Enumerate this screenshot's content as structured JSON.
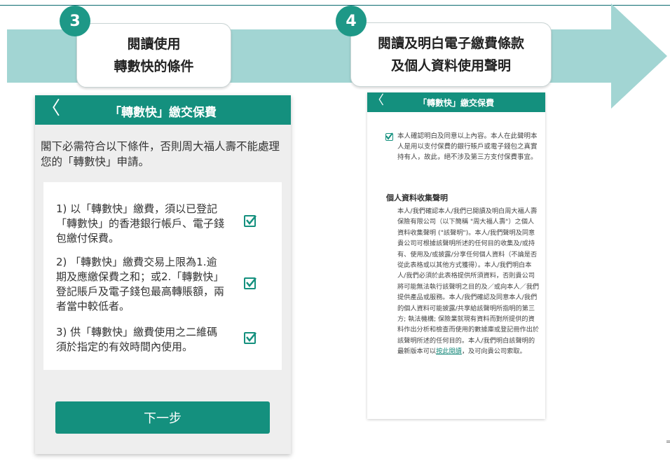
{
  "colors": {
    "teal": "#14907e",
    "arrow": "#a2d5d3",
    "step": "#1e9887"
  },
  "steps": [
    {
      "number": "3",
      "line1": "閱讀使用",
      "line2": "轉數快的條件"
    },
    {
      "number": "4",
      "line1": "閱讀及明白電子繳費條款",
      "line2": "及個人資料使用聲明"
    }
  ],
  "phone1": {
    "title": "「轉數快」繳交保費",
    "back_icon": "chevron-left-icon",
    "intro": "閣下必需符合以下條件，否則周大福人壽不能處理您的「轉數快」申請。",
    "conditions": [
      "1) 以「轉數快」繳費，須以已登記「轉數快」的香港銀行帳戶、電子錢包繳付保費。",
      "2) 「轉數快」繳費交易上限為1.逾期及應繳保費之和；或2.「轉數快」登記賬戶及電子錢包最高轉賬額，兩者當中較低者。",
      "3) 供「轉數快」繳費使用之二維碼須於指定的有效時間內使用。"
    ],
    "next_label": "下一步"
  },
  "phone2": {
    "title": "「轉數快」繳交保費",
    "back_icon": "chevron-left-icon",
    "confirm_text": "本人確認明白及同意以上內容。本人在此聲明本人是用以支付保費的銀行賬戶或電子錢包之真實持有人，故此，絕不涉及第三方支付保費事宜。",
    "section_title": "個人資料收集聲明",
    "body_text": "本人/我們確認本人/我們已閱讀及明白周大福人壽保險有限公司（以下簡稱 \"周大福人壽\"）之個人資料收集聲明 (\"該聲明\")。本人/我們聲明及同意貴公司可根據該聲明所述的任何目的收集及/或持有、使用及/或披露/分享任何個人資料（不論是否從此表格或以其他方式獲得）。本人/我們明白本人/我們必須於此表格提供所須資料，否則貴公司將可能無法執行該聲明之目的及／或向本人／我們提供產品或服務。本人/我們確認及同意本人/我們的個人資料可能披露/共享給該聲明所指明的第三方; 執法機構; 保險業就現有資料而對所提供的資料作出分析和檢查而使用的數據庫或登記冊作出於該聲明所述的任何目的。本人/我們明白該聲明的最新版本可以",
    "link_text": "按此閱讀",
    "body_end": "，及可向貴公司索取。"
  },
  "side_mark": "="
}
